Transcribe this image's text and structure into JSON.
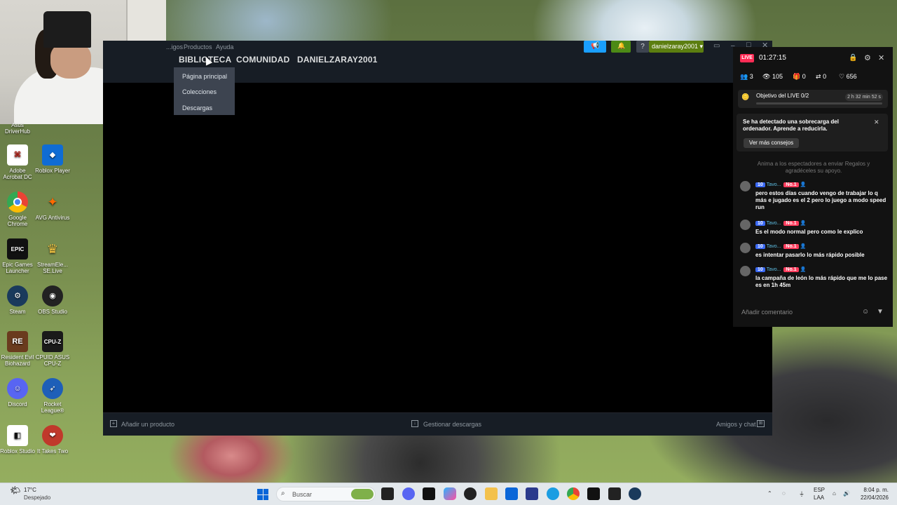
{
  "webcam": {},
  "desktop_icons": [
    {
      "label": "Asus DriverHub",
      "icon": "asus-driverhub-icon",
      "color": "#1c4aa0"
    },
    {
      "label": "Adobe Acrobat DC",
      "icon": "acrobat-icon",
      "color": "#b30b00"
    },
    {
      "label": "Roblox Player",
      "icon": "roblox-player-icon",
      "color": "#0f6cd4"
    },
    {
      "label": "Google Chrome",
      "icon": "chrome-icon",
      "color": "#2f9a4a"
    },
    {
      "label": "AVG Antivirus",
      "icon": "avg-icon",
      "color": "#3f8a2c"
    },
    {
      "label": "Epic Games Launcher",
      "icon": "epic-games-icon",
      "color": "#111111"
    },
    {
      "label": "StreamEle... SE.Live",
      "icon": "streamelements-icon",
      "color": "#2b2b6a"
    },
    {
      "label": "Steam",
      "icon": "steam-icon",
      "color": "#1a3a5c"
    },
    {
      "label": "OBS Studio",
      "icon": "obs-icon",
      "color": "#222222"
    },
    {
      "label": "Resident Evil Biohazard",
      "icon": "resident-evil-icon",
      "color": "#6a3b1e"
    },
    {
      "label": "CPUID ASUS CPU-Z",
      "icon": "cpuz-icon",
      "color": "#1a1a1a"
    },
    {
      "label": "Discord",
      "icon": "discord-icon",
      "color": "#5865f2"
    },
    {
      "label": "Rocket League®",
      "icon": "rocket-league-icon",
      "color": "#1e5fb8"
    },
    {
      "label": "Roblox Studio",
      "icon": "roblox-studio-icon",
      "color": "#111111"
    },
    {
      "label": "It Takes Two",
      "icon": "it-takes-two-icon",
      "color": "#c0392b"
    }
  ],
  "steam": {
    "menu": [
      "...igos",
      "Productos",
      "Ayuda"
    ],
    "nav": [
      "BIBLIOTECA",
      "COMUNIDAD",
      "DANIELZARAY2001"
    ],
    "dropdown": [
      "Página principal",
      "Colecciones",
      "Descargas"
    ],
    "username": "danielzaray2001 ▾",
    "help": "?",
    "footer": {
      "add_product": "Añadir un producto",
      "manage_downloads": "Gestionar descargas",
      "friends_chat": "Amigos y chat"
    }
  },
  "live": {
    "badge": "LIVE",
    "timer": "01:27:15",
    "stats": {
      "viewers_small": "3",
      "views": "105",
      "gifts": "0",
      "shares": "0",
      "likes": "656"
    },
    "objective": {
      "label": "Objetivo del LIVE",
      "progress": "0/2",
      "remaining": "2 h 32 min 52 s"
    },
    "warning": {
      "text": "Se ha detectado una sobrecarga del ordenador. Aprende a reducirla.",
      "button": "Ver más consejos"
    },
    "encourage": "Anima a los espectadores a enviar Regalos y agradéceles su apoyo.",
    "messages": [
      {
        "level": "10",
        "user": "Tavo...",
        "rank": "No.1",
        "text": "pero estos días cuando vengo de trabajar lo q más e jugado es el 2 pero lo juego a modo speed run"
      },
      {
        "level": "10",
        "user": "Tavo...",
        "rank": "No.1",
        "text": "Es el modo normal pero como le explico"
      },
      {
        "level": "10",
        "user": "Tavo...",
        "rank": "No.1",
        "text": "es intentar pasarlo lo más rápido posible"
      },
      {
        "level": "10",
        "user": "Tavo...",
        "rank": "No.1",
        "text": "la campaña de león lo más rápido que me lo pase es en 1h 45m"
      }
    ],
    "comment_placeholder": "Añadir comentario"
  },
  "taskbar": {
    "weather_temp": "17°C",
    "weather_desc": "Despejado",
    "search": "Buscar",
    "lang_top": "ESP",
    "lang_bottom": "LAA",
    "time": "8:04 p. m.",
    "date": "22/04/2026"
  }
}
